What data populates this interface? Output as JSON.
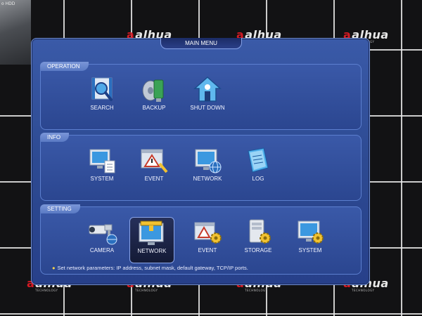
{
  "background": {
    "camera_tile_text": "o HDD",
    "watermark_brand": "alhua",
    "watermark_sub": "TECHNOLOGY"
  },
  "dialog": {
    "title": "MAIN MENU",
    "operation": {
      "label": "OPERATION",
      "items": [
        {
          "label": "SEARCH",
          "icon": "search-icon"
        },
        {
          "label": "BACKUP",
          "icon": "backup-icon"
        },
        {
          "label": "SHUT DOWN",
          "icon": "shutdown-icon"
        }
      ]
    },
    "info": {
      "label": "INFO",
      "items": [
        {
          "label": "SYSTEM",
          "icon": "system-info-icon"
        },
        {
          "label": "EVENT",
          "icon": "event-info-icon"
        },
        {
          "label": "NETWORK",
          "icon": "network-info-icon"
        },
        {
          "label": "LOG",
          "icon": "log-icon"
        }
      ]
    },
    "setting": {
      "label": "SETTING",
      "items": [
        {
          "label": "CAMERA",
          "icon": "camera-icon"
        },
        {
          "label": "NETWORK",
          "icon": "network-setting-icon",
          "selected": true
        },
        {
          "label": "EVENT",
          "icon": "event-setting-icon"
        },
        {
          "label": "STORAGE",
          "icon": "storage-icon"
        },
        {
          "label": "SYSTEM",
          "icon": "system-setting-icon"
        }
      ],
      "hint": "Set network parameters: IP address, subnet mask, default gateway, TCP/IP ports."
    }
  },
  "colors": {
    "dialog_bg": "#2d4a92",
    "panel_label": "#6a88cc",
    "accent_yellow": "#f5d34a",
    "brand_red": "#d41a24"
  }
}
